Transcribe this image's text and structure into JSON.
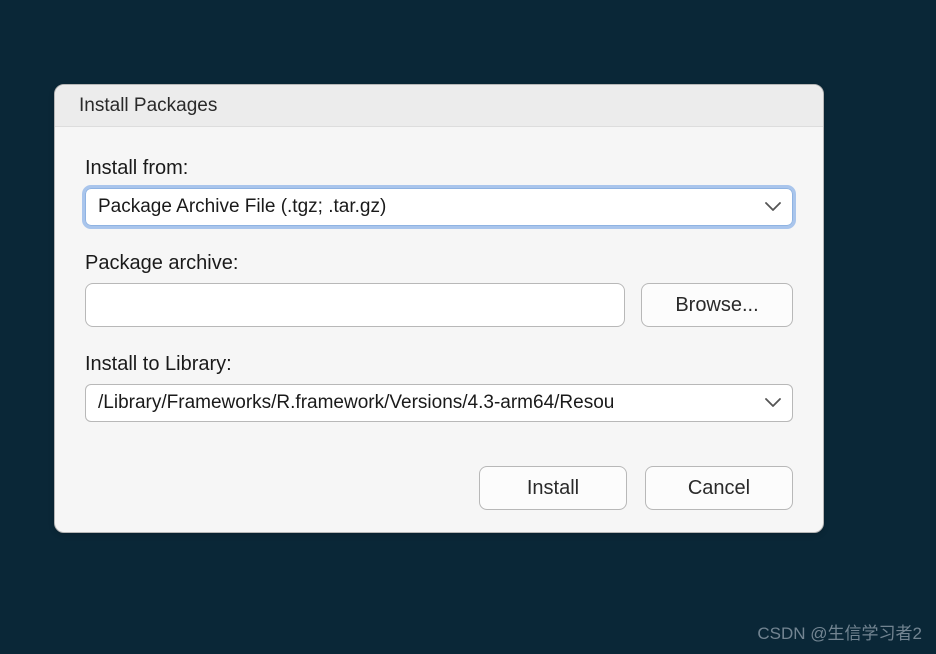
{
  "dialog": {
    "title": "Install Packages",
    "install_from": {
      "label": "Install from:",
      "value": "Package Archive File (.tgz; .tar.gz)"
    },
    "package_archive": {
      "label": "Package archive:",
      "value": "",
      "browse_label": "Browse..."
    },
    "install_to_library": {
      "label": "Install to Library:",
      "value": "/Library/Frameworks/R.framework/Versions/4.3-arm64/Resou"
    },
    "buttons": {
      "install": "Install",
      "cancel": "Cancel"
    }
  },
  "watermark": "CSDN @生信学习者2"
}
